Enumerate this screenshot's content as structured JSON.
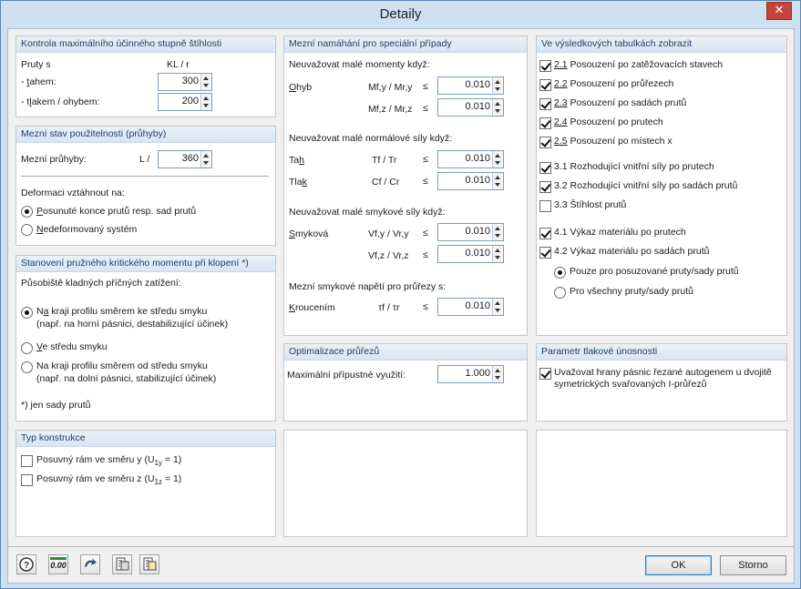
{
  "window": {
    "title": "Detaily",
    "close_glyph": "✕"
  },
  "slenderness": {
    "title": "Kontrola maximálního účinného stupně štíhlosti",
    "col_label": "Pruty s",
    "col_value": "KL / r",
    "tension_label": "- tahem:",
    "tension_value": "300",
    "compression_label": "- tlakem / ohybem:",
    "compression_value": "200"
  },
  "serviceability": {
    "title": "Mezní stav použitelnosti (průhyby)",
    "limit_label": "Mezní průhyby:",
    "limit_unit": "L /",
    "limit_value": "360",
    "ref_label": "Deformaci vztáhnout na:",
    "opt_displaced": "Posunuté konce prutů resp. sad prutů",
    "opt_undeformed": "Nedeformovaný systém"
  },
  "ltb": {
    "title": "Stanovení pružného kritického momentu při klopení *)",
    "load_label": "Působiště kladných příčných zatížení:",
    "opt_edge_center_1": "Na kraji profilu směrem ke středu smyku",
    "opt_edge_center_2": "(např. na horní pásnici, destabilizující účinek)",
    "opt_shear_center": "Ve středu smyku",
    "opt_edge_away_1": "Na kraji profilu směrem od středu smyku",
    "opt_edge_away_2": "(např. na dolní pásnici, stabilizující účinek)",
    "footnote": "*) jen sady prutů"
  },
  "construction": {
    "title": "Typ konstrukce",
    "sway_y": "Posuvný rám ve směru y (U",
    "sway_y_sub": "1y",
    "sway_y_end": " = 1)",
    "sway_z": "Posuvný rám ve směru z (U",
    "sway_z_sub": "1z",
    "sway_z_end": " = 1)"
  },
  "limit_stress": {
    "title": "Mezní namáhání pro speciální případy",
    "moments_label": "Neuvažovat malé momenty když:",
    "bending_label": "Ohyb",
    "my_formula": "Mf,y / Mr,y",
    "my_op": "≤",
    "my_value": "0.010",
    "mz_formula": "Mf,z / Mr,z",
    "mz_op": "≤",
    "mz_value": "0.010",
    "normal_label": "Neuvažovat malé normálové síly když:",
    "tension_label": "Tah",
    "t_formula": "Tf / Tr",
    "t_op": "≤",
    "t_value": "0.010",
    "compression_label": "Tlak",
    "c_formula": "Cf / Cr",
    "c_op": "≤",
    "c_value": "0.010",
    "shear_label": "Neuvažovat malé smykové síly když:",
    "shear_name": "Smyková",
    "vy_formula": "Vf,y / Vr,y",
    "vy_op": "≤",
    "vy_value": "0.010",
    "vz_formula": "Vf,z / Vr,z",
    "vz_op": "≤",
    "vz_value": "0.010",
    "torsion_label": "Mezní smykové napětí pro průřezy s:",
    "torsion_name": "Kroucením",
    "tau_formula": "τf / τr",
    "tau_op": "≤",
    "tau_value": "0.010"
  },
  "optimization": {
    "title": "Optimalizace průřezů",
    "util_label": "Maximální přípustné využití:",
    "util_value": "1.000"
  },
  "results": {
    "title": "Ve výsledkových tabulkách zobrazit",
    "items": [
      {
        "num": "2.1",
        "label": "Posouzení po zatěžovacích stavech"
      },
      {
        "num": "2.2",
        "label": "Posouzení po průřezech"
      },
      {
        "num": "2.3",
        "label": "Posouzení po sadách prutů"
      },
      {
        "num": "2.4",
        "label": "Posouzení po prutech"
      },
      {
        "num": "2.5",
        "label": "Posouzení po místech x"
      },
      {
        "num": "3.1",
        "label": "Rozhodující vnitřní síly po prutech"
      },
      {
        "num": "3.2",
        "label": "Rozhodující vnitřní síly po sadách prutů"
      },
      {
        "num": "3.3",
        "label": "Štíhlost prutů"
      },
      {
        "num": "4.1",
        "label": "Výkaz materiálu po prutech"
      },
      {
        "num": "4.2",
        "label": "Výkaz materiálu po sadách prutů"
      }
    ],
    "opt_designed": "Pouze pro posuzované pruty/sady prutů",
    "opt_all": "Pro všechny pruty/sady prutů"
  },
  "compressive": {
    "title": "Parametr tlakové únosnosti",
    "option_1": "Uvažovat hrany pásnic řezané autogenem u dvojitě",
    "option_2": "symetrických svařovaných I-průřezů"
  },
  "footer": {
    "ok": "OK",
    "cancel": "Storno",
    "num_btn": "0.00"
  }
}
